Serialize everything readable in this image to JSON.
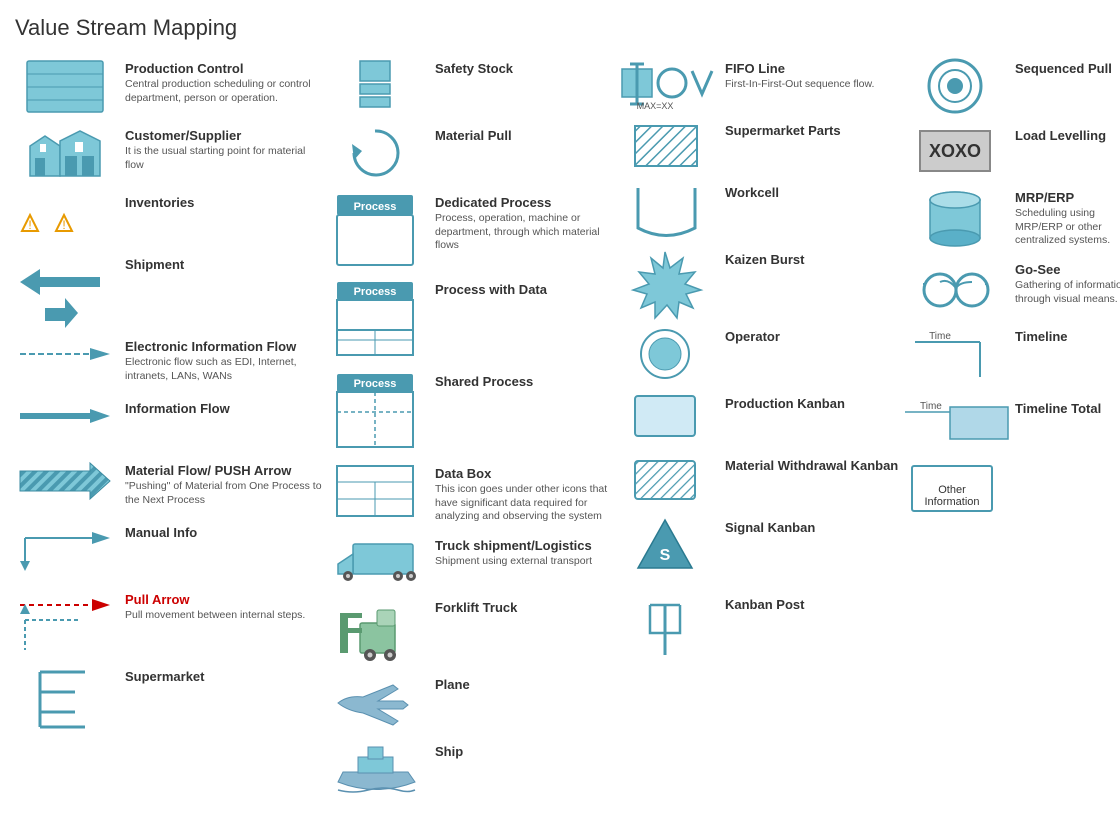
{
  "title": "Value Stream Mapping",
  "columns": [
    {
      "items": [
        {
          "id": "production-control",
          "label": "Production Control",
          "sub": "Central production scheduling or control department, person or operation.",
          "icon": "production-control-icon"
        },
        {
          "id": "customer-supplier",
          "label": "Customer/Supplier",
          "sub": "It is the usual starting point for material flow",
          "icon": "customer-supplier-icon"
        },
        {
          "id": "inventories",
          "label": "Inventories",
          "sub": "",
          "icon": "inventories-icon"
        },
        {
          "id": "shipment",
          "label": "Shipment",
          "sub": "",
          "icon": "shipment-icon"
        },
        {
          "id": "electronic-info-flow",
          "label": "Electronic Information Flow",
          "sub": "Electronic flow such as EDI, Internet, intranets, LANs, WANs",
          "icon": "electronic-info-icon"
        },
        {
          "id": "information-flow",
          "label": "Information Flow",
          "sub": "",
          "icon": "information-flow-icon"
        },
        {
          "id": "material-flow",
          "label": "Material Flow/ PUSH Arrow",
          "sub": "\"Pushing\" of Material from One Process to the Next Process",
          "icon": "material-flow-icon"
        },
        {
          "id": "manual-info",
          "label": "Manual Info",
          "sub": "",
          "icon": "manual-info-icon"
        },
        {
          "id": "pull-arrow",
          "label": "Pull Arrow",
          "sub": "Pull movement between internal steps.",
          "icon": "pull-arrow-icon",
          "label_color": "red"
        },
        {
          "id": "supermarket",
          "label": "Supermarket",
          "sub": "",
          "icon": "supermarket-icon"
        }
      ]
    },
    {
      "items": [
        {
          "id": "safety-stock",
          "label": "Safety Stock",
          "sub": "",
          "icon": "safety-stock-icon"
        },
        {
          "id": "material-pull",
          "label": "Material Pull",
          "sub": "",
          "icon": "material-pull-icon"
        },
        {
          "id": "dedicated-process",
          "label": "Dedicated Process",
          "sub": "Process, operation, machine or department, through which material flows",
          "icon": "dedicated-process-icon"
        },
        {
          "id": "process-with-data",
          "label": "Process with Data",
          "sub": "",
          "icon": "process-with-data-icon"
        },
        {
          "id": "shared-process",
          "label": "Shared Process",
          "sub": "",
          "icon": "shared-process-icon"
        },
        {
          "id": "data-box",
          "label": "Data Box",
          "sub": "This icon goes under other icons that have significant data required for analyzing and observing the system",
          "icon": "data-box-icon"
        },
        {
          "id": "truck-shipment",
          "label": "Truck shipment/Logistics",
          "sub": "Shipment using external transport",
          "icon": "truck-icon"
        },
        {
          "id": "forklift-truck",
          "label": "Forklift Truck",
          "sub": "",
          "icon": "forklift-icon"
        },
        {
          "id": "plane",
          "label": "Plane",
          "sub": "",
          "icon": "plane-icon"
        },
        {
          "id": "ship",
          "label": "Ship",
          "sub": "",
          "icon": "ship-icon"
        }
      ]
    },
    {
      "items": [
        {
          "id": "fifo-line",
          "label": "FIFO Line",
          "sub": "First-In-First-Out sequence flow.",
          "icon": "fifo-icon"
        },
        {
          "id": "supermarket-parts",
          "label": "Supermarket Parts",
          "sub": "",
          "icon": "supermarket-parts-icon"
        },
        {
          "id": "workcell",
          "label": "Workcell",
          "sub": "",
          "icon": "workcell-icon"
        },
        {
          "id": "kaizen-burst",
          "label": "Kaizen Burst",
          "sub": "",
          "icon": "kaizen-burst-icon"
        },
        {
          "id": "operator",
          "label": "Operator",
          "sub": "",
          "icon": "operator-icon"
        },
        {
          "id": "production-kanban",
          "label": "Production Kanban",
          "sub": "",
          "icon": "production-kanban-icon"
        },
        {
          "id": "material-withdrawal",
          "label": "Material Withdrawal Kanban",
          "sub": "",
          "icon": "material-withdrawal-icon"
        },
        {
          "id": "signal-kanban",
          "label": "Signal Kanban",
          "sub": "",
          "icon": "signal-kanban-icon"
        },
        {
          "id": "kanban-post",
          "label": "Kanban Post",
          "sub": "",
          "icon": "kanban-post-icon"
        }
      ]
    },
    {
      "items": [
        {
          "id": "sequenced-pull",
          "label": "Sequenced Pull",
          "sub": "",
          "icon": "sequenced-pull-icon"
        },
        {
          "id": "load-levelling",
          "label": "Load Levelling",
          "sub": "",
          "icon": "load-levelling-icon"
        },
        {
          "id": "mrp-erp",
          "label": "MRP/ERP",
          "sub": "Scheduling using MRP/ERP or other centralized systems.",
          "icon": "mrp-erp-icon"
        },
        {
          "id": "go-see",
          "label": "Go-See",
          "sub": "Gathering of information through visual means.",
          "icon": "go-see-icon"
        },
        {
          "id": "timeline",
          "label": "Timeline",
          "sub": "",
          "icon": "timeline-icon"
        },
        {
          "id": "timeline-total",
          "label": "Timeline Total",
          "sub": "",
          "icon": "timeline-total-icon"
        },
        {
          "id": "other-information",
          "label": "Other Information",
          "sub": "",
          "icon": "other-info-icon"
        }
      ]
    }
  ]
}
